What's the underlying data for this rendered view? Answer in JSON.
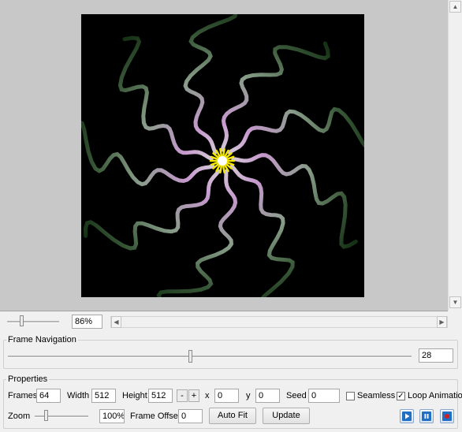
{
  "viewer": {
    "zoom_display": "86%"
  },
  "frame_navigation": {
    "title": "Frame Navigation",
    "frame_value": "28"
  },
  "properties": {
    "title": "Properties",
    "frames_label": "Frames",
    "frames_value": "64",
    "width_label": "Width",
    "width_value": "512",
    "height_label": "Height",
    "height_value": "512",
    "minus_label": "-",
    "plus_label": "+",
    "x_label": "x",
    "x_value": "0",
    "y_label": "y",
    "y_value": "0",
    "seed_label": "Seed",
    "seed_value": "0",
    "seamless_label": "Seamless",
    "seamless_checked": false,
    "loop_label": "Loop Animation",
    "loop_checked": true,
    "zoom_label": "Zoom",
    "zoom_value": "100%",
    "frame_offset_label": "Frame Offset",
    "frame_offset_value": "0",
    "auto_fit_label": "Auto Fit",
    "update_label": "Update"
  },
  "icons": {
    "play": "play-icon",
    "pause": "pause-icon",
    "record": "record-icon",
    "scroll_up": "arrow-up-icon",
    "scroll_down": "arrow-down-icon",
    "scroll_left": "arrow-left-icon",
    "scroll_right": "arrow-right-icon"
  },
  "colors": {
    "canvas_bg": "#000000",
    "flower_center": "#f3e600",
    "arm_inner": "#e9b4f2",
    "arm_outer": "#3d8a3a",
    "media_accent": "#1f6fc7",
    "record": "#d02020"
  }
}
